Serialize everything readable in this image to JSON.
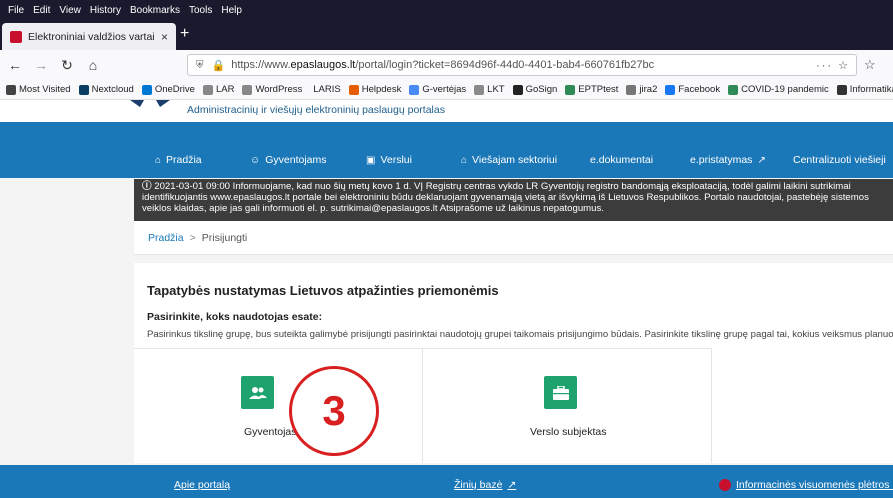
{
  "browser": {
    "menu": [
      "File",
      "Edit",
      "View",
      "History",
      "Bookmarks",
      "Tools",
      "Help"
    ],
    "tab_title": "Elektroniniai valdžios vartai",
    "tab_close": "×",
    "new_tab": "+",
    "url_prefix": "https://www.",
    "url_domain": "epaslaugos.lt",
    "url_rest": "/portal/login?ticket=8694d96f-44d0-4401-bab4-660761fb27bc",
    "url_actions": "··· ☆",
    "bookmarks": [
      {
        "label": "Most Visited",
        "icon": "gear-icon",
        "color": "#444444"
      },
      {
        "label": "Nextcloud",
        "icon": "folder-icon",
        "color": "#0a3d62"
      },
      {
        "label": "OneDrive",
        "icon": "cloud-icon",
        "color": "#0078d4"
      },
      {
        "label": "LAR",
        "icon": "page-icon",
        "color": "#888888"
      },
      {
        "label": "WordPress",
        "icon": "page-icon",
        "color": "#888888"
      },
      {
        "label": "LARIS",
        "icon": "blank-icon",
        "color": "#ffffff"
      },
      {
        "label": "Helpdesk",
        "icon": "helpdesk-icon",
        "color": "#e65c00"
      },
      {
        "label": "G-vertėjas",
        "icon": "translate-icon",
        "color": "#4a8af4"
      },
      {
        "label": "LKT",
        "icon": "lkt-icon",
        "color": "#8a8a8a"
      },
      {
        "label": "GoSign",
        "icon": "gosign-icon",
        "color": "#222222"
      },
      {
        "label": "EPTPtest",
        "icon": "eptp-icon",
        "color": "#2e8b57"
      },
      {
        "label": "jira2",
        "icon": "jira-icon",
        "color": "#777777"
      },
      {
        "label": "Facebook",
        "icon": "facebook-icon",
        "color": "#1877f2"
      },
      {
        "label": "COVID-19 pandemic",
        "icon": "covid-icon",
        "color": "#2e8b57"
      },
      {
        "label": "Informatika",
        "icon": "globe-icon",
        "color": "#333333"
      }
    ]
  },
  "site": {
    "tagline": "Administracinių ir viešųjų elektroninių paslaugų portalas",
    "nav": [
      {
        "label": "Pradžia",
        "icon": "home-icon",
        "glyph": "🏠"
      },
      {
        "label": "Gyventojams",
        "icon": "users-icon",
        "glyph": "👥"
      },
      {
        "label": "Verslui",
        "icon": "briefcase-icon",
        "glyph": "💼"
      },
      {
        "label": "Viešajam sektoriui",
        "icon": "institution-icon",
        "glyph": "🏛"
      },
      {
        "label": "e.dokumentai",
        "icon": "",
        "glyph": ""
      },
      {
        "label": "e.pristatymas",
        "icon": "external-icon",
        "glyph": "↗"
      },
      {
        "label": "Centralizuoti viešieji",
        "icon": "",
        "glyph": ""
      }
    ],
    "notice": "2021-03-01 09:00  Informuojame, kad nuo šių metų kovo 1 d. VĮ Registrų centras vykdo LR Gyventojų registro bandomąją eksploataciją, todėl galimi laikini sutrikimai identifikuojantis www.epaslaugos.lt portale bei elektroniniu būdu deklaruojant gyvenamąją vietą ar išvykimą iš Lietuvos Respublikos. Portalo naudotojai, pastebėję sistemos veiklos klaidas, apie jas gali informuoti el. p. sutrikimai@epaslaugos.lt Atsiprašome už laikinus nepatogumus.",
    "breadcrumb": {
      "home": "Pradžia",
      "sep": ">",
      "current": "Prisijungti"
    },
    "heading": "Tapatybės nustatymas Lietuvos atpažinties priemonėmis",
    "subheading": "Pasirinkite, koks naudotojas esate:",
    "description": "Pasirinkus tikslinę grupę, bus suteikta galimybė prisijungti pasirinktai naudotojų grupei taikomais prisijungimo būdais. Pasirinkite tikslinę grupę pagal tai, kokius veiksmus planuojate atlikti prisijungę.",
    "tiles": [
      {
        "label": "Gyventojas",
        "icon": "users-icon",
        "glyph": "👥"
      },
      {
        "label": "Verslo subjektas",
        "icon": "briefcase-icon",
        "glyph": "💼"
      }
    ],
    "annotation_number": "3",
    "footer": [
      {
        "label": "Apie portalą",
        "icon": ""
      },
      {
        "label": "Žinių bazė",
        "icon": "external-icon",
        "glyph": "↗"
      },
      {
        "label": "Informacinės visuomenės plėtros komitetas",
        "icon": "logo-icon",
        "glyph": ""
      }
    ],
    "colors": {
      "nav_blue": "#1a77b8",
      "tile_green": "#1ea36f",
      "annotation_red": "#d82020",
      "notice_bg": "#3c3c3c"
    }
  }
}
